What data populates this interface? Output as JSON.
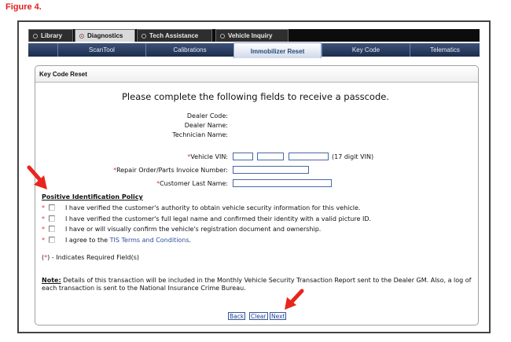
{
  "figure_label": "Figure 4.",
  "top_tabs": [
    {
      "label": "Library",
      "active": false
    },
    {
      "label": "Diagnostics",
      "active": true
    },
    {
      "label": "Tech Assistance",
      "active": false
    },
    {
      "label": "Vehicle Inquiry",
      "active": false
    }
  ],
  "sub_tabs": [
    {
      "label": "ScanTool"
    },
    {
      "label": "Calibrations"
    },
    {
      "label": "Immobilizer Reset",
      "active": true
    },
    {
      "label": "Key Code"
    },
    {
      "label": "Telematics"
    }
  ],
  "panel": {
    "title": "Key Code Reset",
    "headline": "Please complete the following fields to receive a passcode.",
    "info": {
      "dealer_code_label": "Dealer Code:",
      "dealer_name_label": "Dealer Name:",
      "technician_name_label": "Technician Name:"
    },
    "fields": {
      "required_mark": "*",
      "vin_label": "Vehicle VIN:",
      "vin_hint": "(17 digit VIN)",
      "repair_order_label": "Repair Order/Parts Invoice Number:",
      "last_name_label": "Customer Last Name:"
    },
    "policy": {
      "title": "Positive Identification Policy",
      "items": [
        "I have verified the customer's authority to obtain vehicle security information for this vehicle.",
        "I have verified the customer's full legal name and confirmed their identity with a valid picture ID.",
        "I have or will visually confirm the vehicle's registration document and ownership.",
        "I agree to the"
      ],
      "terms_link": "TIS Terms and Conditions",
      "terms_suffix": "."
    },
    "required_note": {
      "open": "(",
      "mark": "*",
      "close": ") - Indicates Required Field(s)"
    },
    "note": {
      "label": "Note:",
      "text": " Details of this transaction will be included in the Monthly Vehicle Security Transaction Report sent to the Dealer GM. Also, a log of each transaction is sent to the National Insurance Crime Bureau."
    },
    "buttons": {
      "back": "Back",
      "clear": "Clear",
      "next": "Next"
    }
  },
  "colors": {
    "arrow": "#e8251d",
    "figure_label": "#e0201c",
    "nav": "#1c2d4d",
    "link": "#2a4fa0"
  }
}
